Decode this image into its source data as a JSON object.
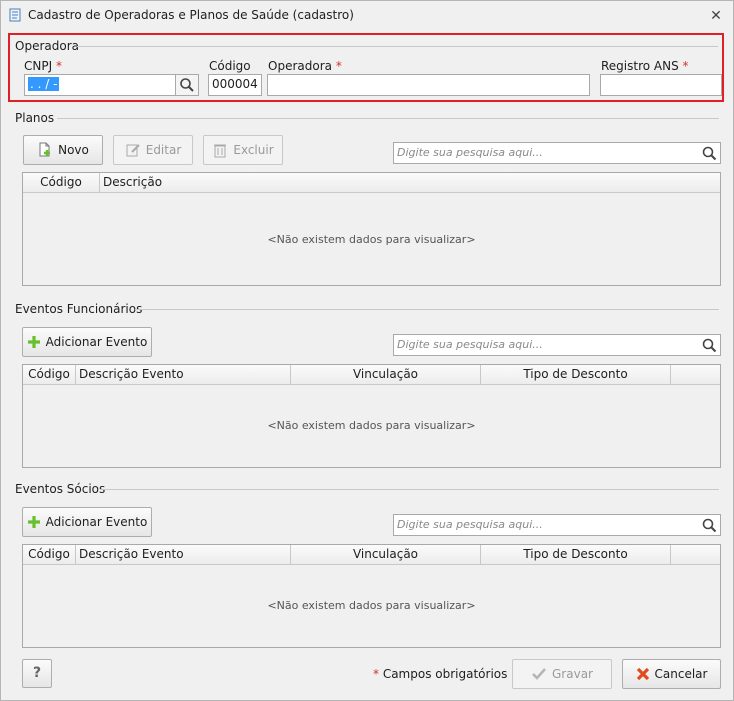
{
  "window": {
    "title": "Cadastro de Operadoras e Planos de Saúde (cadastro)"
  },
  "operadora": {
    "section_label": "Operadora",
    "cnpj_label": "CNPJ",
    "cnpj_value": " .  .  /  -",
    "codigo_label": "Código",
    "codigo_value": "000004",
    "operadora_label": "Operadora",
    "operadora_value": "",
    "registro_label": "Registro ANS",
    "registro_value": "",
    "required_mark": "*"
  },
  "planos": {
    "section_label": "Planos",
    "buttons": {
      "novo": "Novo",
      "editar": "Editar",
      "excluir": "Excluir"
    },
    "search_placeholder": "Digite sua pesquisa aqui...",
    "columns": [
      "Código",
      "Descrição"
    ],
    "empty_text": "<Não existem dados para visualizar>"
  },
  "eventos_funcionarios": {
    "section_label": "Eventos Funcionários",
    "add_button": "Adicionar Evento",
    "search_placeholder": "Digite sua pesquisa aqui...",
    "columns": [
      "Código",
      "Descrição Evento",
      "Vinculação",
      "Tipo de Desconto"
    ],
    "empty_text": "<Não existem dados para visualizar>"
  },
  "eventos_socios": {
    "section_label": "Eventos Sócios",
    "add_button": "Adicionar Evento",
    "search_placeholder": "Digite sua pesquisa aqui...",
    "columns": [
      "Código",
      "Descrição Evento",
      "Vinculação",
      "Tipo de Desconto"
    ],
    "empty_text": "<Não existem dados para visualizar>"
  },
  "footer": {
    "help_label": "?",
    "required_mark": "*",
    "required_note": "Campos obrigatórios",
    "save_label": "Gravar",
    "cancel_label": "Cancelar"
  },
  "colors": {
    "highlight": "#e01f26",
    "required": "#d32f2f",
    "selection": "#3399ff"
  }
}
